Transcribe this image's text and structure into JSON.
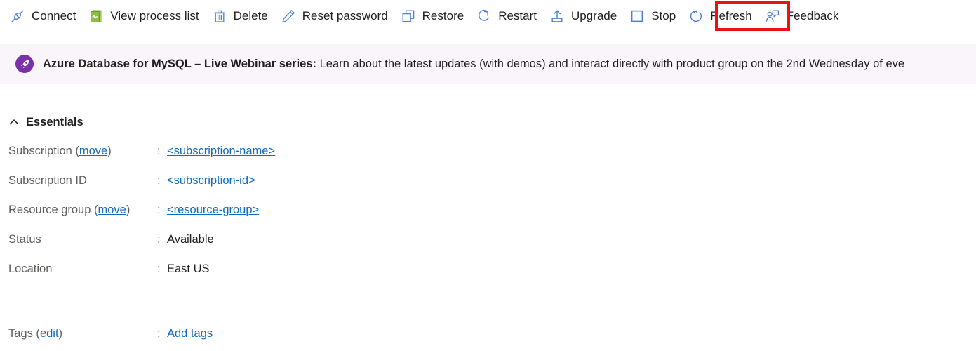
{
  "toolbar": {
    "buttons": [
      {
        "label": "Connect",
        "icon": "plug-icon"
      },
      {
        "label": "View process list",
        "icon": "process-list-icon"
      },
      {
        "label": "Delete",
        "icon": "trash-icon"
      },
      {
        "label": "Reset password",
        "icon": "pencil-icon"
      },
      {
        "label": "Restore",
        "icon": "restore-icon"
      },
      {
        "label": "Restart",
        "icon": "restart-icon"
      },
      {
        "label": "Upgrade",
        "icon": "upgrade-icon"
      },
      {
        "label": "Stop",
        "icon": "stop-square-icon"
      },
      {
        "label": "Refresh",
        "icon": "refresh-icon"
      },
      {
        "label": "Feedback",
        "icon": "feedback-person-icon"
      }
    ],
    "highlighted_button": "Stop",
    "highlight_color": "#ee1111",
    "icon_color": "#4a7ed6"
  },
  "banner": {
    "icon": "rocket-icon",
    "icon_bg_color": "#7b2fa8",
    "background_color": "#faf5fb",
    "title": "Azure Database for MySQL – Live Webinar series:",
    "body": " Learn about the latest updates (with demos) and interact directly with product group on the 2nd Wednesday of eve"
  },
  "essentials": {
    "collapse_icon": "chevron-up-icon",
    "title": "Essentials",
    "rows": [
      {
        "label_prefix": "Subscription (",
        "label_link": "move",
        "label_suffix": ")",
        "colon": ":",
        "value": "<subscription-name>",
        "value_is_link": true
      },
      {
        "label_prefix": "Subscription ID",
        "label_link": "",
        "label_suffix": "",
        "colon": ":",
        "value": "<subscription-id>",
        "value_is_link": true
      },
      {
        "label_prefix": "Resource group (",
        "label_link": "move",
        "label_suffix": ")",
        "colon": ":",
        "value": "<resource-group>",
        "value_is_link": true
      },
      {
        "label_prefix": "Status",
        "label_link": "",
        "label_suffix": "",
        "colon": ":",
        "value": "Available",
        "value_is_link": false
      },
      {
        "label_prefix": "Location",
        "label_link": "",
        "label_suffix": "",
        "colon": ":",
        "value": "East US",
        "value_is_link": false
      }
    ],
    "tags": {
      "label_prefix": "Tags (",
      "label_link": "edit",
      "label_suffix": ")",
      "colon": ":",
      "value": "Add tags"
    }
  }
}
